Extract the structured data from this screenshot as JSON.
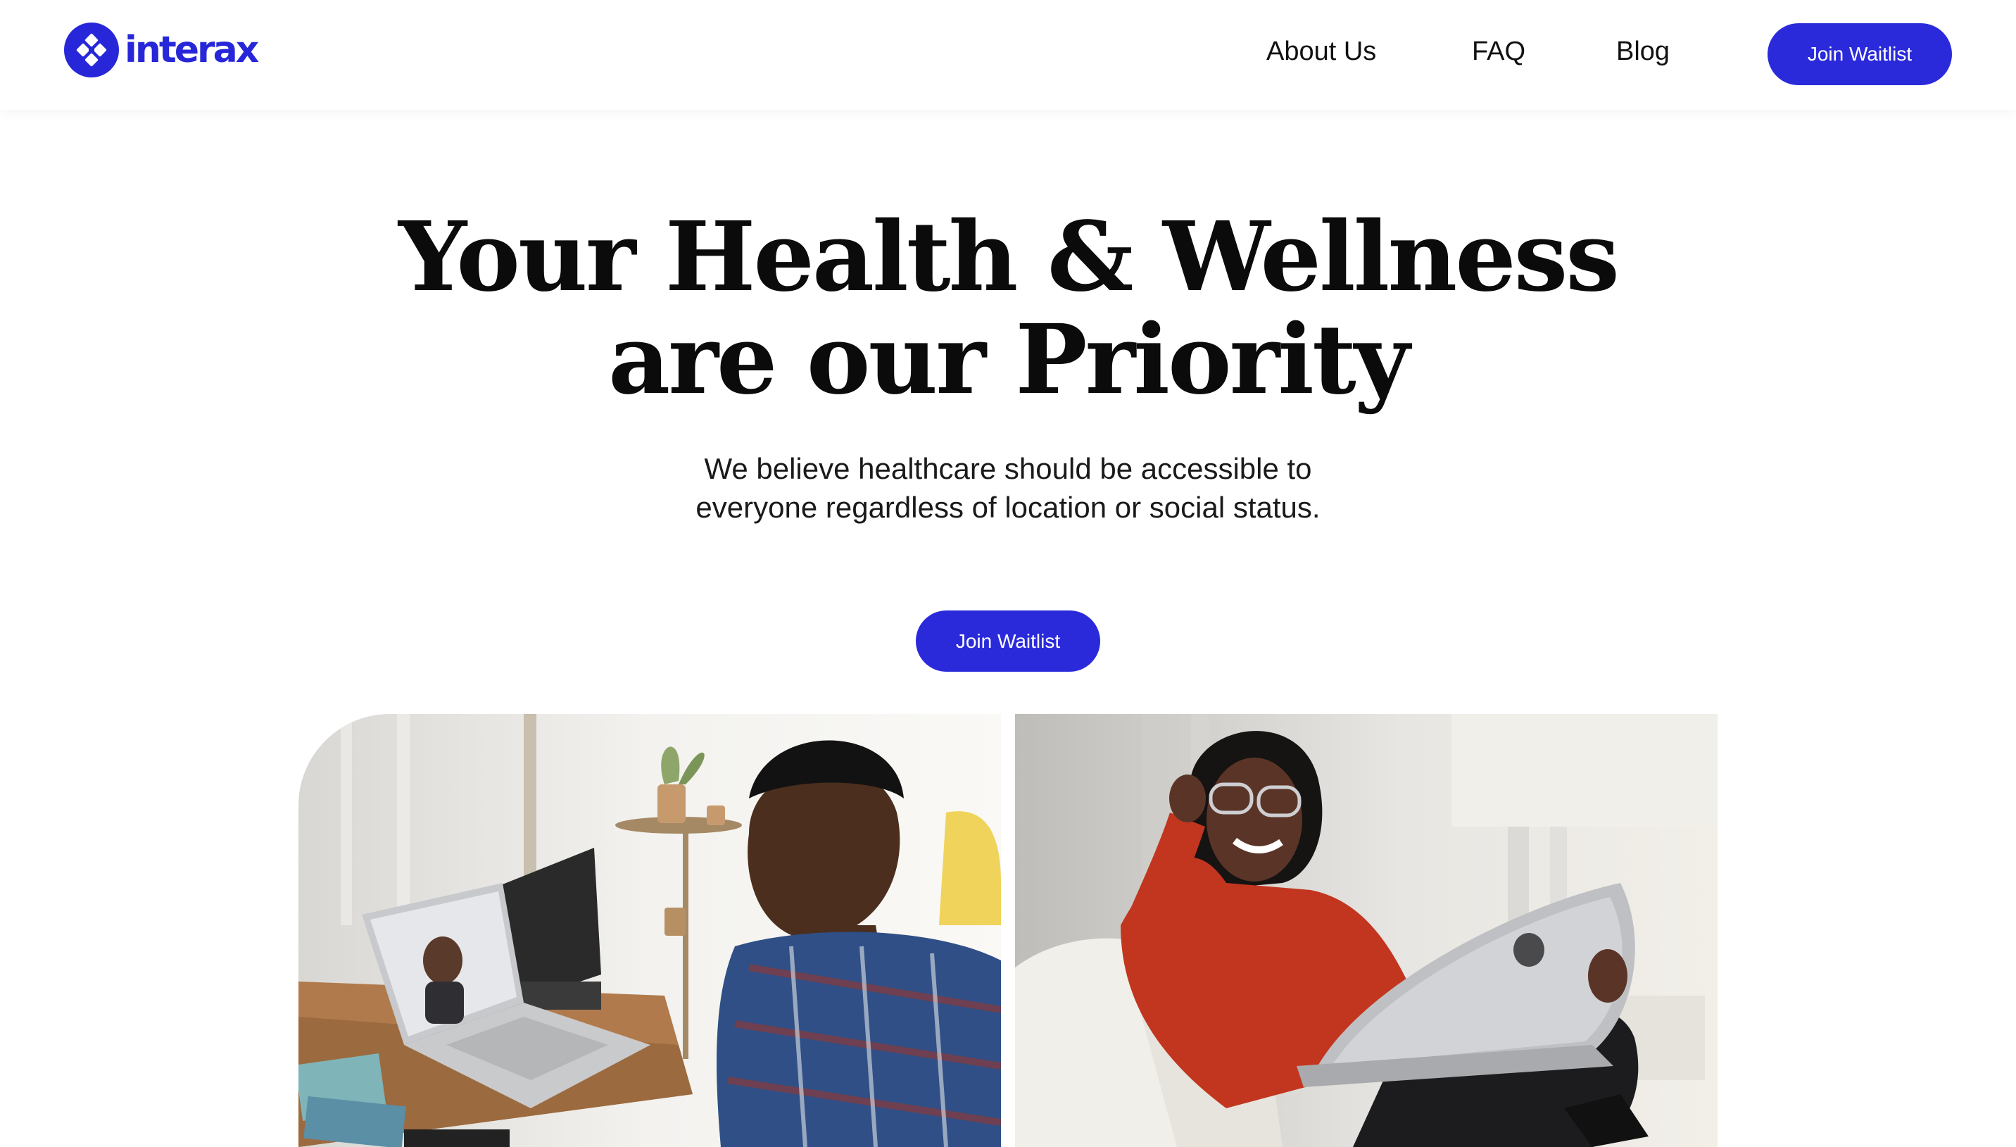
{
  "brand": {
    "name": "interax",
    "color": "#2727d9"
  },
  "nav": {
    "links": [
      "About Us",
      "FAQ",
      "Blog"
    ],
    "cta_label": "Join Waitlist"
  },
  "hero": {
    "title_line1": "Your Health & Wellness",
    "title_line2": "are our Priority",
    "subtitle_line1": "We believe healthcare should be accessible to",
    "subtitle_line2": "everyone regardless of location or social status.",
    "cta_label": "Join Waitlist"
  },
  "images": [
    {
      "name": "man-video-call-photo"
    },
    {
      "name": "woman-laptop-photo"
    }
  ],
  "icons": {
    "logo": "interax-logo-icon"
  },
  "colors": {
    "accent": "#2a2adb",
    "text": "#111111",
    "background": "#ffffff"
  }
}
